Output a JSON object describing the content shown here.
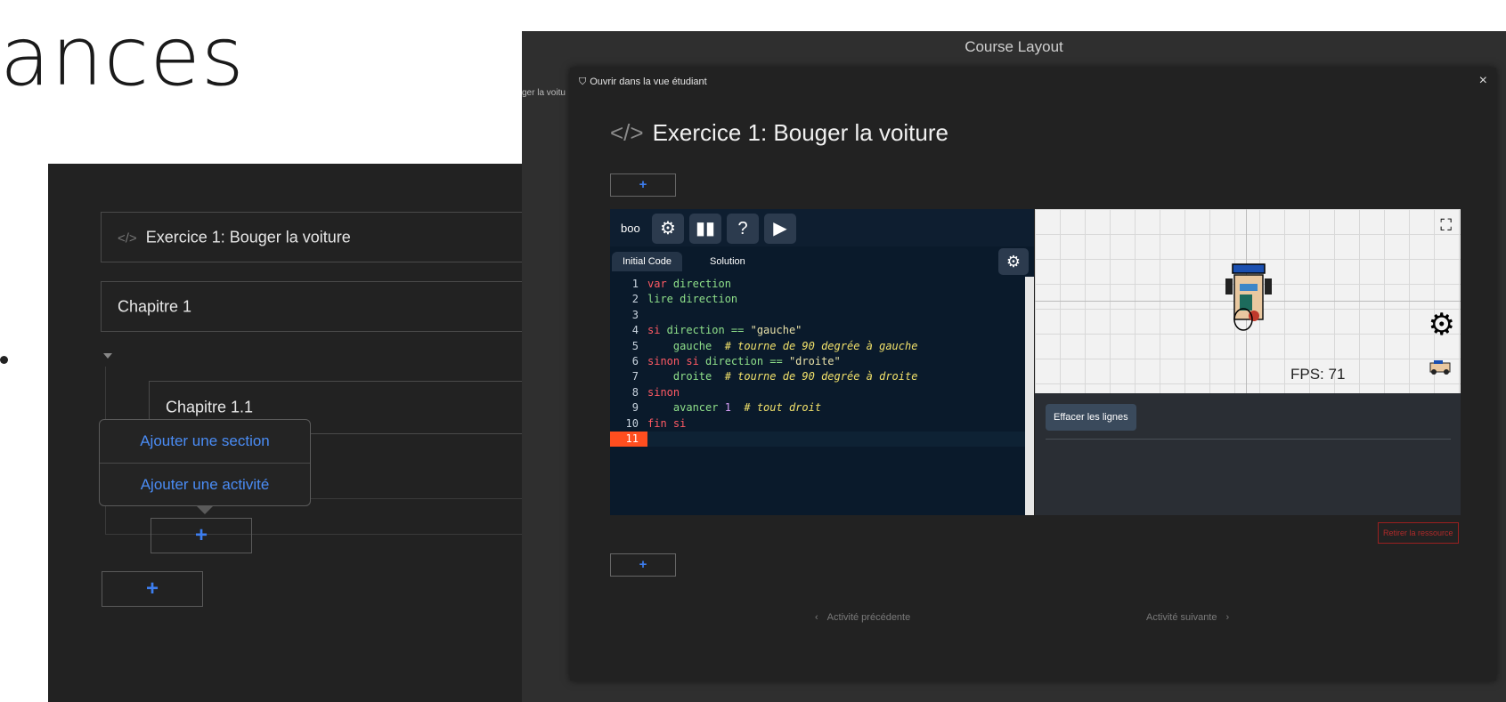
{
  "slide": {
    "title_fragment": "ances"
  },
  "left_panel": {
    "activity_title": "Exercice 1: Bouger la voiture",
    "chapter_1": "Chapitre 1",
    "chapter_1_1": "Chapitre 1.1",
    "add_section": "Ajouter une section",
    "add_activity": "Ajouter une activité",
    "plus": "+"
  },
  "course_window": {
    "title": "Course Layout",
    "strip_text": "ger la voitu"
  },
  "modal": {
    "open_student_view": "Ouvrir dans la vue étudiant",
    "close": "×",
    "exercise_title": "Exercice 1: Bouger la voiture",
    "plus": "+",
    "editor": {
      "name": "boo",
      "tabs": [
        "Initial Code",
        "Solution"
      ],
      "lines": [
        {
          "n": "1"
        },
        {
          "n": "2"
        },
        {
          "n": "3"
        },
        {
          "n": "4"
        },
        {
          "n": "5"
        },
        {
          "n": "6"
        },
        {
          "n": "7"
        },
        {
          "n": "8"
        },
        {
          "n": "9"
        },
        {
          "n": "10"
        },
        {
          "n": "11"
        }
      ],
      "code": {
        "l1_kw": "var",
        "l1_id": " direction",
        "l2_id": "lire direction",
        "l4_kw": "si",
        "l4_id": " direction == ",
        "l4_str": "\"gauche\"",
        "l5_id": "    gauche  ",
        "l5_com": "# tourne de 90 degrée à gauche",
        "l6_kw": "sinon si",
        "l6_id": " direction == ",
        "l6_str": "\"droite\"",
        "l7_id": "    droite  ",
        "l7_com": "# tourne de 90 degrée à droite",
        "l8_kw": "sinon",
        "l9_id": "    avancer ",
        "l9_num": "1",
        "l9_com": "  # tout droit",
        "l10_kw": "fin si"
      }
    },
    "simulator": {
      "fps_label": "FPS: 71",
      "clear_lines": "Effacer les lignes"
    },
    "remove_resource": "Retirer la ressource",
    "prev_activity": "Activité précédente",
    "next_activity": "Activité suivante",
    "colors": {
      "accent_blue": "#3d7ef0",
      "current_line": "#ff4e1f",
      "danger": "#b02a2a"
    }
  }
}
